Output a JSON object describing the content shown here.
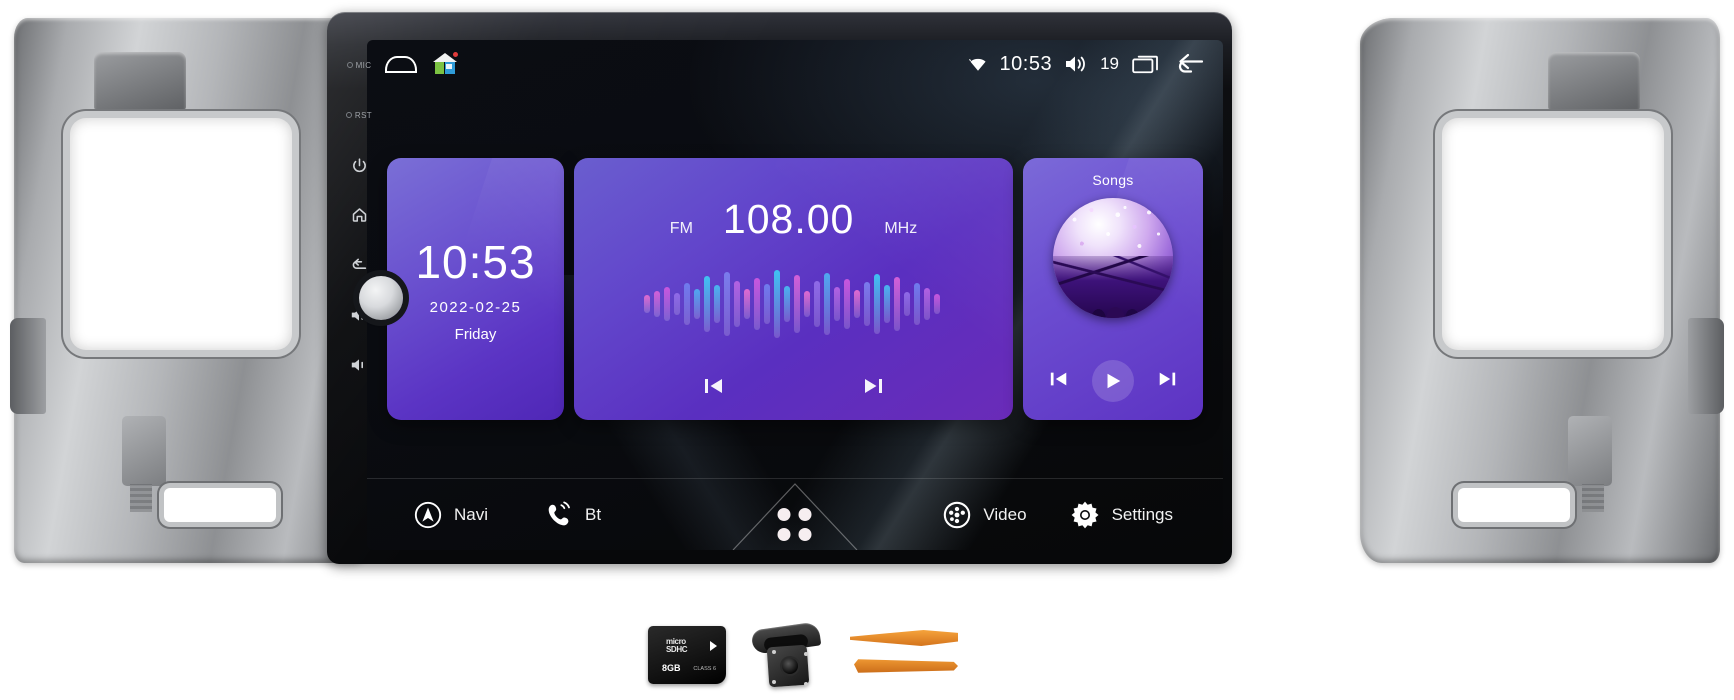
{
  "product": {
    "type": "android-car-head-unit",
    "fascia_color": "#a9abae"
  },
  "bezel": {
    "keys": [
      {
        "name": "mic",
        "label": "MIC",
        "icon": "mic-dot-icon"
      },
      {
        "name": "reset",
        "label": "RST",
        "icon": "reset-dot-icon"
      },
      {
        "name": "power",
        "label": "",
        "icon": "power-icon"
      },
      {
        "name": "home",
        "label": "",
        "icon": "home-icon"
      },
      {
        "name": "back",
        "label": "",
        "icon": "back-arrow-icon"
      },
      {
        "name": "volume-up",
        "label": "",
        "icon": "volume-up-icon"
      },
      {
        "name": "volume-down",
        "label": "",
        "icon": "volume-down-icon"
      }
    ],
    "knob_label": ""
  },
  "statusbar": {
    "home_icon": "home-trapezoid-icon",
    "app_icon": "mini-house-icon",
    "wifi_icon": "wifi-icon",
    "time": "10:53",
    "volume_icon": "volume-icon",
    "volume_level": "19",
    "recents_icon": "recent-apps-icon",
    "back_icon": "back-arrow-icon"
  },
  "widgets": {
    "clock": {
      "time": "10:53",
      "date": "2022-02-25",
      "weekday": "Friday"
    },
    "radio": {
      "band": "FM",
      "frequency": "108.00",
      "unit": "MHz",
      "prev_icon": "skip-previous-icon",
      "next_icon": "skip-next-icon",
      "equalizer": {
        "heights": [
          18,
          26,
          34,
          22,
          42,
          30,
          56,
          38,
          64,
          46,
          30,
          52,
          40,
          68,
          36,
          58,
          26,
          46,
          62,
          34,
          50,
          28,
          44,
          60,
          38,
          54,
          24,
          42,
          32,
          20
        ],
        "colors": [
          "#e06ad0",
          "#d35fd8",
          "#c856de",
          "#8f6ae8",
          "#6f7bee",
          "#4fa8f0",
          "#3fc2f2",
          "#49b4ef",
          "#7a7ced",
          "#b261e2",
          "#e06ad0",
          "#c856de",
          "#6f7bee",
          "#3fc2f2",
          "#49b4ef",
          "#d35fd8",
          "#e06ad0",
          "#8f6ae8",
          "#4fa8f0",
          "#b261e2",
          "#c856de",
          "#e06ad0",
          "#7a7ced",
          "#3fc2f2",
          "#49b4ef",
          "#d35fd8",
          "#8f6ae8",
          "#6f7bee",
          "#b261e2",
          "#c856de"
        ]
      }
    },
    "songs": {
      "title": "Songs",
      "album_art": "concert-crowd-album-art",
      "prev_icon": "skip-previous-icon",
      "play_icon": "play-icon",
      "next_icon": "skip-next-icon"
    }
  },
  "dock": {
    "left": [
      {
        "label": "Navi",
        "icon": "compass-navigation-icon"
      },
      {
        "label": "Bt",
        "icon": "phone-bluetooth-icon"
      }
    ],
    "app_drawer": {
      "label": "",
      "icon": "app-drawer-dots-icon"
    },
    "right": [
      {
        "label": "Video",
        "icon": "film-reel-icon"
      },
      {
        "label": "Settings",
        "icon": "gear-icon"
      }
    ]
  },
  "accessories": [
    {
      "name": "microsd-card",
      "brand_line": "micro",
      "type_line": "SDHC",
      "capacity": "8GB",
      "class": "CLASS 6"
    },
    {
      "name": "rear-view-camera",
      "label": ""
    },
    {
      "name": "pry-tools",
      "label": ""
    }
  ],
  "colors": {
    "accent_purple": "#5b34c4",
    "screen_black": "#07080a",
    "fascia_silver": "#a9abae"
  }
}
